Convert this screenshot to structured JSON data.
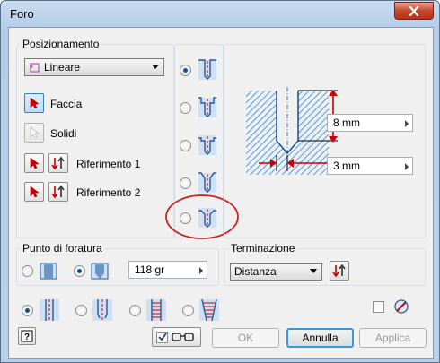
{
  "window": {
    "title": "Foro"
  },
  "icons": {
    "close": "close-icon",
    "help": "help-icon"
  },
  "positioning": {
    "title": "Posizionamento",
    "mode": "Lineare",
    "face_label": "Faccia",
    "solids_label": "Solidi",
    "ref1_label": "Riferimento 1",
    "ref2_label": "Riferimento 2"
  },
  "hole_types": {
    "selected_index": 0,
    "count": 5
  },
  "preview": {
    "depth_value": "8 mm",
    "diameter_value": "3 mm"
  },
  "drill_point": {
    "title": "Punto di foratura",
    "angle_value": "118 gr",
    "selected": "angled"
  },
  "termination": {
    "title": "Terminazione",
    "value": "Distanza"
  },
  "thread_types": {
    "selected_index": 0
  },
  "buttons": {
    "ok": "OK",
    "cancel": "Annulla",
    "apply": "Applica"
  },
  "colors": {
    "accent": "#cc0000",
    "hatch": "#4a7fb5",
    "annotation_circle": "#cc2222"
  }
}
